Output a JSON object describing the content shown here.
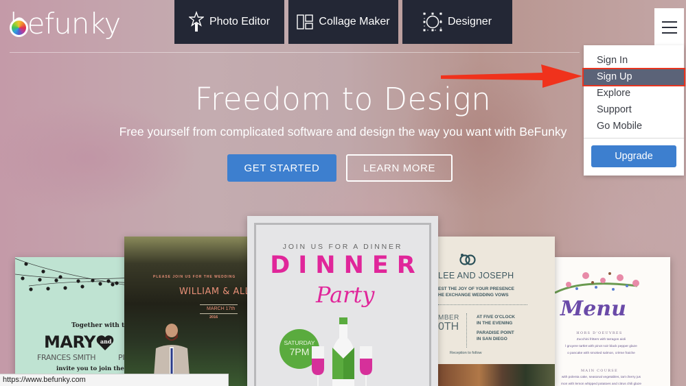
{
  "header": {
    "logo_text": "befunky",
    "tabs": [
      {
        "label": "Photo Editor",
        "icon": "magic-wand-star-icon"
      },
      {
        "label": "Collage Maker",
        "icon": "collage-layout-icon"
      },
      {
        "label": "Designer",
        "icon": "selection-circle-icon"
      }
    ],
    "menu_icon": "hamburger-icon"
  },
  "dropdown": {
    "items": [
      {
        "label": "Sign In",
        "highlighted": false
      },
      {
        "label": "Sign Up",
        "highlighted": true
      },
      {
        "label": "Explore",
        "highlighted": false
      },
      {
        "label": "Support",
        "highlighted": false
      },
      {
        "label": "Go Mobile",
        "highlighted": false
      }
    ],
    "upgrade_label": "Upgrade"
  },
  "annotation": {
    "type": "arrow",
    "target": "Sign Up",
    "color": "#e8341f"
  },
  "hero": {
    "title": "Freedom to Design",
    "subtitle": "Free yourself from complicated software and design the way you want with BeFunky",
    "primary_button": "GET STARTED",
    "secondary_button": "LEARN MORE"
  },
  "cards": {
    "mint": {
      "together": "Together with their p",
      "name": "MARY",
      "and": "and",
      "fullname": "FRANCES SMITH",
      "fullname_partial": "PI",
      "invite": "invite you to join them as t"
    },
    "wedding": {
      "please": "PLEASE JOIN US FOR THE WEDDING",
      "names": "WILLIAM & ALLISON",
      "date": "MARCH 17th",
      "year": "2016"
    },
    "dinner": {
      "join": "JOIN US FOR A DINNER",
      "title": "DINNER",
      "party": "Party",
      "day": "SATURDAY",
      "time": "7PM"
    },
    "lee": {
      "names": "LEE AND JOSEPH",
      "request_1": "EST THE JOY OF YOUR PRESENCE",
      "request_2": "HE EXCHANGE WEDDING VOWS",
      "month": "MBER",
      "day": "0TH",
      "time_1": "AT FIVE O'CLOCK",
      "time_2": "IN THE EVENING",
      "place_1": "PARADISE POINT",
      "place_2": "IN SAN DIEGO",
      "reception": "Reception to follow"
    },
    "menu": {
      "title": "Menu",
      "section_1": "HORS D'OEUVRES",
      "lines_1": [
        "Zucchini fritters with tarragon aioli",
        "l gruyere tartlet with pinot noir black pepper glaze",
        "o pancake with smoked salmon, crème fraiche"
      ],
      "section_2": "MAIN COURSE",
      "lines_2": [
        "with polenta cake, seasonal vegetables, tart cherry jus",
        "mon with lemon whipped potatoes and citrus chili glaze"
      ]
    }
  },
  "status_bar": {
    "url": "https://www.befunky.com"
  }
}
